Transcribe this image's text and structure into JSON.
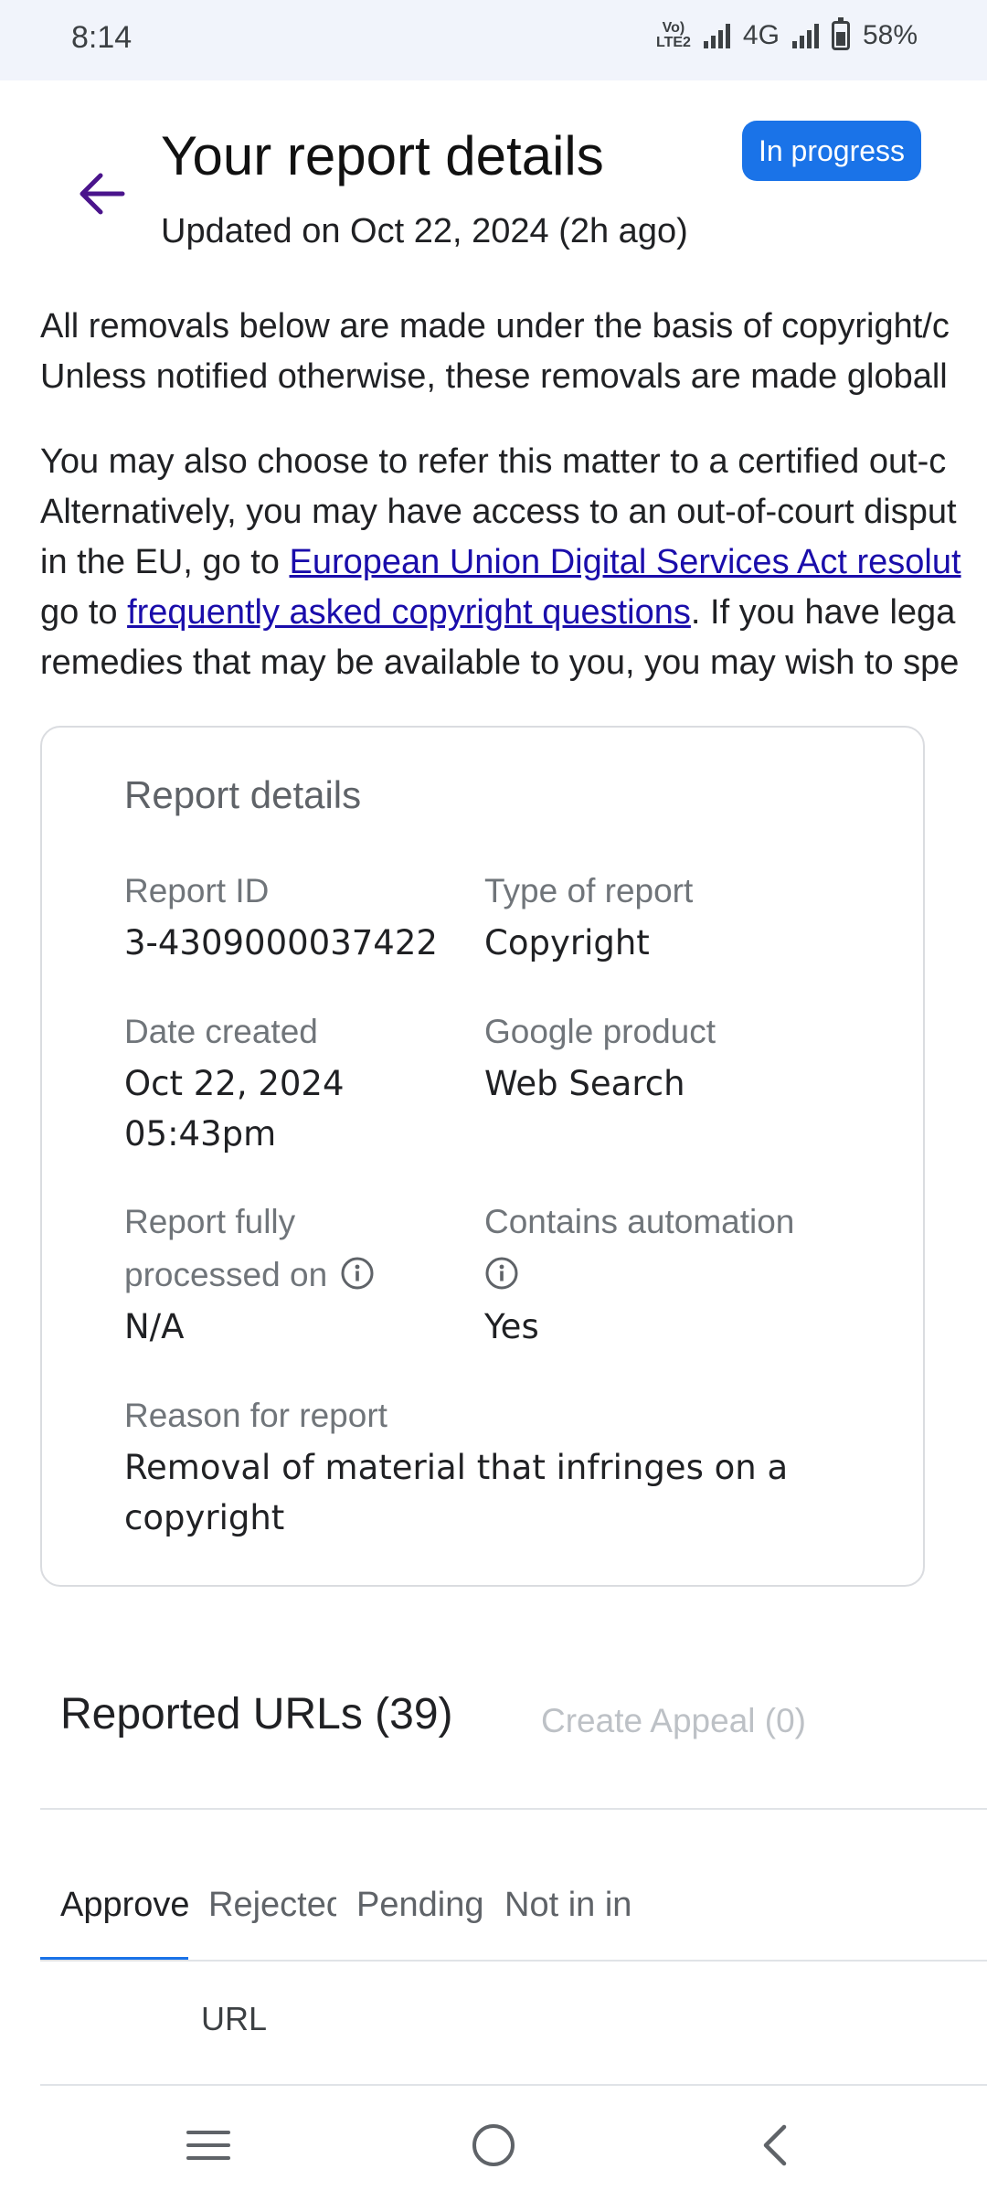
{
  "status_bar": {
    "time": "8:14",
    "volte": "Vo LTE2",
    "network": "4G",
    "battery": "58%",
    "battery_level": 0.58
  },
  "header": {
    "title": "Your report details",
    "updated": "Updated on Oct 22, 2024 (2h ago)",
    "status_chip": "In progress",
    "back_icon": "arrow-back-icon"
  },
  "intro": {
    "para1_line1": "All removals below are made under the basis of copyright/c",
    "para1_line2": "Unless notified otherwise, these removals are made globall",
    "para2_line1": "You may also choose to refer this matter to a certified out-c",
    "para2_line2": "Alternatively, you may have access to an out-of-court disput",
    "para2_line3_pre": "in the EU, go to ",
    "para2_link1": "European Union Digital Services Act resolut",
    "para2_line4_pre": "go to ",
    "para2_link2": "frequently asked copyright questions",
    "para2_line4_post": ". If you have lega",
    "para2_line5": "remedies that may be available to you, you may wish to spe"
  },
  "card": {
    "title": "Report details",
    "report_id_label": "Report ID",
    "report_id_value": "3-4309000037422",
    "type_label": "Type of report",
    "type_value": "Copyright",
    "date_label": "Date created",
    "date_value_line1": "Oct 22, 2024",
    "date_value_line2": "05:43pm",
    "product_label": "Google product",
    "product_value": "Web Search",
    "processed_label_line1": "Report fully",
    "processed_label_line2": "processed on",
    "processed_value": "N/A",
    "automation_label": "Contains automation",
    "automation_value": "Yes",
    "reason_label": "Reason for report",
    "reason_value_line1": "Removal of material that infringes on a",
    "reason_value_line2": "copyright"
  },
  "urls": {
    "title": "Reported URLs (39)",
    "create_appeal": "Create Appeal (0)",
    "tabs": [
      "Approved",
      "Rejected",
      "Pending",
      "Not in index"
    ],
    "active_tab": 0,
    "column_header": "URL"
  },
  "colors": {
    "accent": "#1a73e8",
    "back_arrow": "#4a148c",
    "link": "#1a0dab",
    "status_bar_bg": "#f1f4fb"
  }
}
